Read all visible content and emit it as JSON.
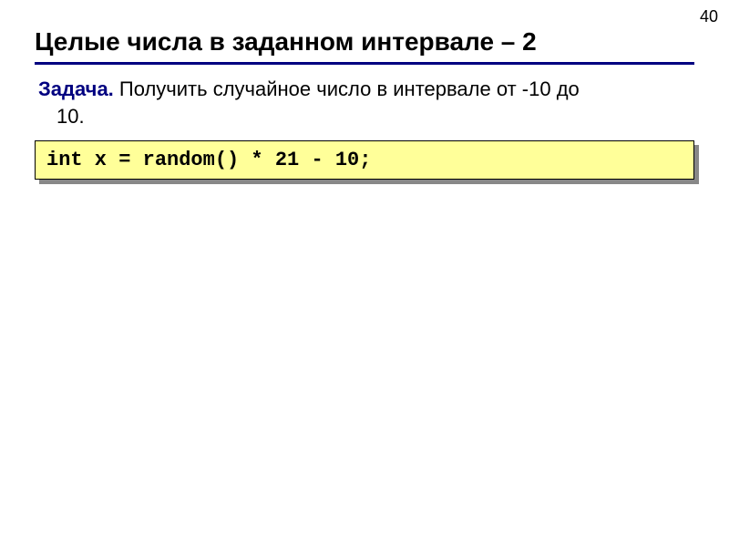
{
  "page_number": "40",
  "slide": {
    "title": "Целые числа в заданном интервале – 2",
    "task_label": "Задача.",
    "task_text_line1": " Получить случайное число в интервале от -10 до",
    "task_text_line2": "10.",
    "code": "int x = random() * 21 - 10;"
  }
}
